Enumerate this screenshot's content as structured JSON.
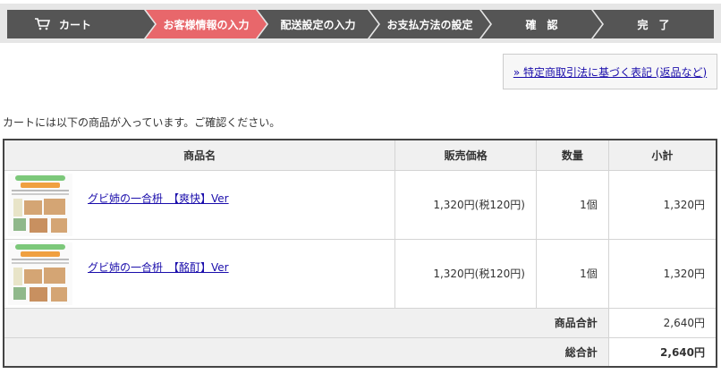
{
  "steps": [
    {
      "label": "カート",
      "icon": "cart-icon",
      "active": false
    },
    {
      "label": "お客様情報の入力",
      "active": true
    },
    {
      "label": "配送設定の入力",
      "active": false
    },
    {
      "label": "お支払方法の設定",
      "active": false
    },
    {
      "label": "確　認",
      "active": false
    },
    {
      "label": "完　了",
      "active": false
    }
  ],
  "colors": {
    "step_bg": "#555555",
    "step_active": "#e8676b",
    "link": "#1a0dab"
  },
  "legal_link": "» 特定商取引法に基づく表記 (返品など)",
  "intro": "カートには以下の商品が入っています。ご確認ください。",
  "table": {
    "headers": [
      "商品名",
      "販売価格",
      "数量",
      "小計"
    ],
    "items": [
      {
        "name": "グビ姉の一合枡　【爽快】Ver",
        "price": "1,320円(税120円)",
        "qty": "1個",
        "subtotal": "1,320円"
      },
      {
        "name": "グビ姉の一合枡　【酩酊】Ver",
        "price": "1,320円(税120円)",
        "qty": "1個",
        "subtotal": "1,320円"
      }
    ],
    "product_total_label": "商品合計",
    "product_total": "2,640円",
    "grand_total_label": "総合計",
    "grand_total": "2,640円"
  }
}
